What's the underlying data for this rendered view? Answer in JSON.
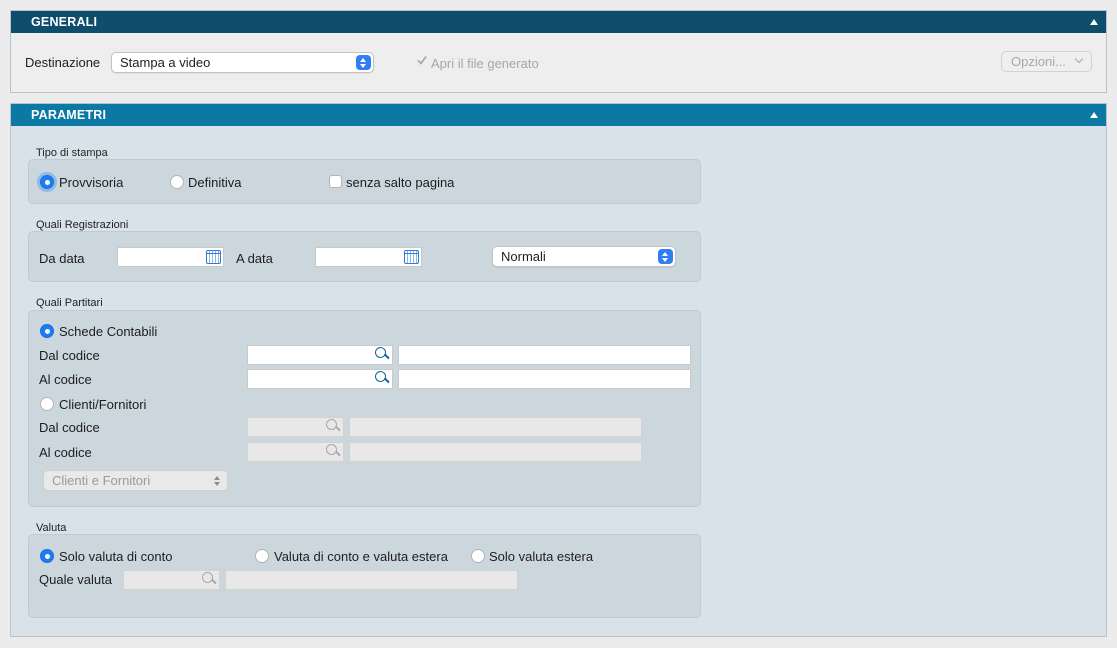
{
  "generali": {
    "title": "GENERALI",
    "destinazione_label": "Destinazione",
    "destinazione_value": "Stampa a video",
    "apri_file_label": "Apri il file generato",
    "opzioni_label": "Opzioni..."
  },
  "parametri": {
    "title": "PARAMETRI",
    "tipo_stampa": {
      "title": "Tipo di stampa",
      "provvisoria": "Provvisoria",
      "definitiva": "Definitiva",
      "senza_salto": "senza salto pagina"
    },
    "registrazioni": {
      "title": "Quali Registrazioni",
      "da_data": "Da data",
      "a_data": "A data",
      "tipo_value": "Normali"
    },
    "partitari": {
      "title": "Quali Partitari",
      "schede_contabili": "Schede Contabili",
      "dal_codice": "Dal codice",
      "al_codice": "Al codice",
      "clienti_fornitori": "Clienti/Fornitori",
      "cf_select_value": "Clienti e Fornitori"
    },
    "valuta": {
      "title": "Valuta",
      "solo_conto": "Solo valuta di conto",
      "conto_estera": "Valuta di conto e valuta estera",
      "solo_estera": "Solo valuta estera",
      "quale_valuta": "Quale valuta"
    }
  }
}
